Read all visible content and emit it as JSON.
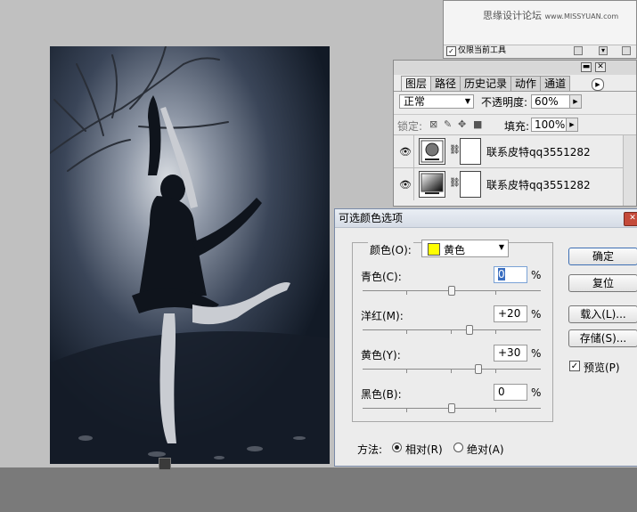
{
  "tool_panel": {
    "watermark": "思缘设计论坛",
    "watermark_url": "www.MISSYUAN.com",
    "checkbox_mark": "✓",
    "current_tool_only_label": "仅限当前工具"
  },
  "layers_panel": {
    "tabs": [
      "图层",
      "路径",
      "历史记录",
      "动作",
      "通道"
    ],
    "minimize_glyph": "▬",
    "close_glyph": "✕",
    "blend_mode": "正常",
    "opacity_label": "不透明度:",
    "opacity_value": "60%",
    "lock_label": "锁定:",
    "fill_label": "填充:",
    "fill_value": "100%",
    "layers": [
      {
        "name": "联系皮特qq3551282",
        "thumb": "levels"
      },
      {
        "name": "联系皮特qq3551282",
        "thumb": "gradient"
      }
    ]
  },
  "dialog": {
    "title": "可选颜色选项",
    "close_glyph": "✕",
    "colors_label": "颜色(O):",
    "colors_value": "黄色",
    "swatch_color": "#ffff00",
    "sliders": [
      {
        "label": "青色(C):",
        "value": "0",
        "level": 0
      },
      {
        "label": "洋红(M):",
        "value": "+20",
        "level": 20
      },
      {
        "label": "黄色(Y):",
        "value": "+30",
        "level": 30
      },
      {
        "label": "黑色(B):",
        "value": "0",
        "level": 0
      }
    ],
    "percent": "%",
    "buttons": {
      "ok": "确定",
      "reset": "复位",
      "load": "载入(L)...",
      "save": "存储(S)..."
    },
    "preview_label": "预览(P)",
    "preview_checked": true,
    "method_label": "方法:",
    "method_relative": "相对(R)",
    "method_absolute": "绝对(A)",
    "method_selected": "relative"
  }
}
